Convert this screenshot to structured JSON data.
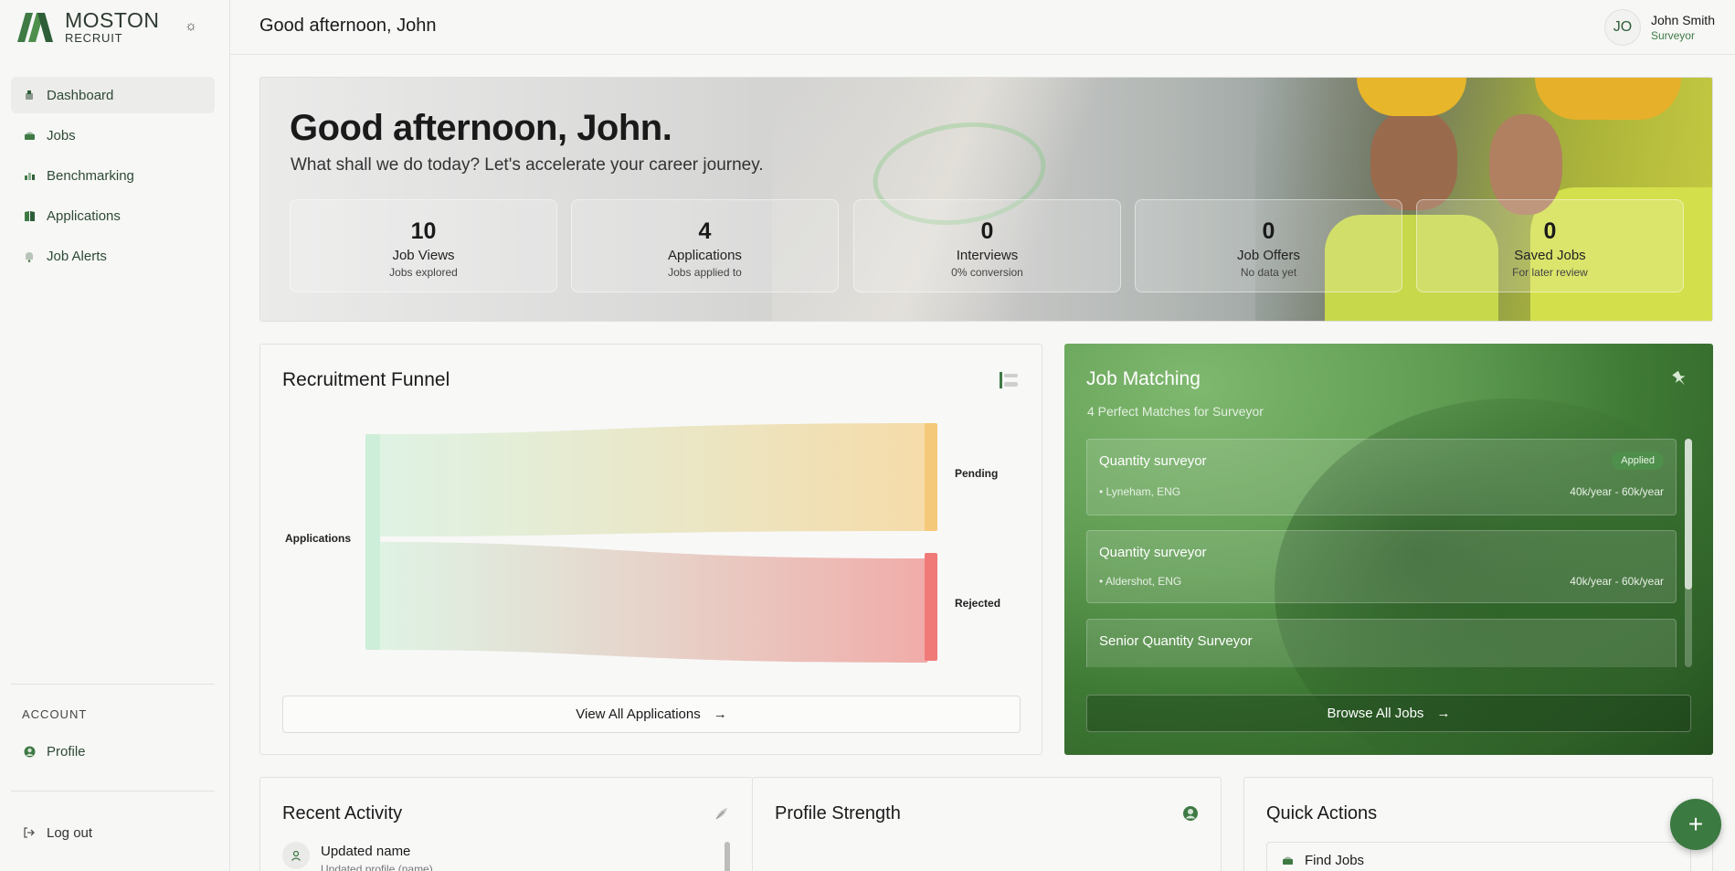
{
  "brand": {
    "name": "MOSTON",
    "sub": "RECRUIT"
  },
  "sidebar": {
    "items": [
      {
        "label": "Dashboard",
        "icon": "dashboard-icon"
      },
      {
        "label": "Jobs",
        "icon": "briefcase-icon"
      },
      {
        "label": "Benchmarking",
        "icon": "chart-icon"
      },
      {
        "label": "Applications",
        "icon": "document-icon"
      },
      {
        "label": "Job Alerts",
        "icon": "bell-icon"
      }
    ],
    "account_label": "ACCOUNT",
    "profile_label": "Profile",
    "logout_label": "Log out"
  },
  "header": {
    "title": "Good afternoon, John",
    "user_initials": "JO",
    "user_name": "John Smith",
    "user_role": "Surveyor"
  },
  "hero": {
    "greeting": "Good afternoon, John.",
    "subtitle": "What shall we do today? Let's accelerate your career journey.",
    "stats": [
      {
        "value": "10",
        "label": "Job Views",
        "note": "Jobs explored"
      },
      {
        "value": "4",
        "label": "Applications",
        "note": "Jobs applied to"
      },
      {
        "value": "0",
        "label": "Interviews",
        "note": "0% conversion"
      },
      {
        "value": "0",
        "label": "Job Offers",
        "note": "No data yet"
      },
      {
        "value": "0",
        "label": "Saved Jobs",
        "note": "For later review"
      }
    ]
  },
  "funnel": {
    "title": "Recruitment Funnel",
    "source_label": "Applications",
    "targets": [
      {
        "label": "Pending",
        "color": "#f5c97a"
      },
      {
        "label": "Rejected",
        "color": "#ef7a78"
      }
    ],
    "source_color": "#cdeed8",
    "view_all_label": "View All Applications"
  },
  "matching": {
    "title": "Job Matching",
    "subtitle": "4 Perfect Matches for Surveyor",
    "jobs": [
      {
        "title": "Quantity surveyor",
        "location": "• Lyneham, ENG",
        "salary": "40k/year - 60k/year",
        "badge": "Applied"
      },
      {
        "title": "Quantity surveyor",
        "location": "• Aldershot, ENG",
        "salary": "40k/year - 60k/year"
      },
      {
        "title": "Senior Quantity Surveyor"
      }
    ],
    "browse_label": "Browse All Jobs"
  },
  "activity": {
    "title": "Recent Activity",
    "items": [
      {
        "title": "Updated name",
        "sub": "Updated profile (name)"
      }
    ]
  },
  "profile_strength": {
    "title": "Profile Strength"
  },
  "quick_actions": {
    "title": "Quick Actions",
    "items": [
      {
        "label": "Find Jobs"
      }
    ]
  }
}
